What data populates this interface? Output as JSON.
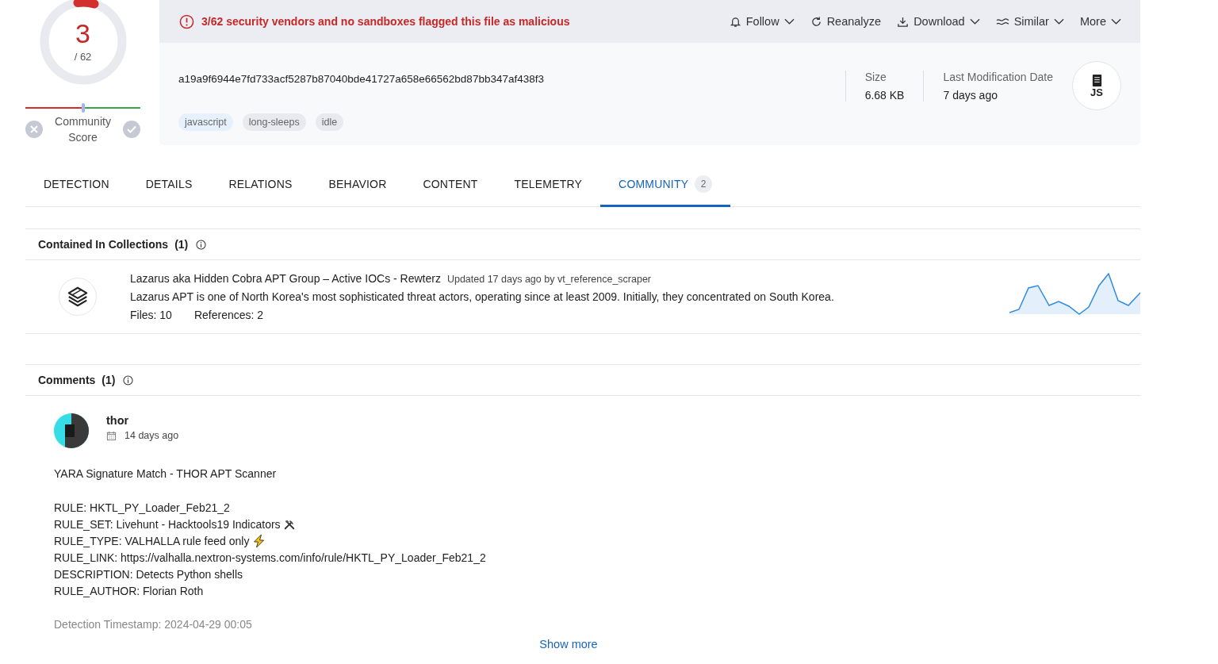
{
  "score": {
    "detections": "3",
    "total": "/ 62",
    "community_label": "Community Score",
    "community": {
      "level": 0.5
    }
  },
  "alert": {
    "message": "3/62 security vendors and no sandboxes flagged this file as malicious"
  },
  "actions": [
    {
      "label": "Follow",
      "kind": "bell",
      "dropdown": true
    },
    {
      "label": "Reanalyze",
      "kind": "refresh",
      "dropdown": false
    },
    {
      "label": "Download",
      "kind": "download",
      "dropdown": true
    },
    {
      "label": "Similar",
      "kind": "similar",
      "dropdown": true
    },
    {
      "label": "More",
      "kind": "plain",
      "dropdown": true
    }
  ],
  "file": {
    "hash": "a19a9f6944e7fd733acf5287b87040bde41727a658e66562bd87bb347af438f3",
    "tags": [
      {
        "label": "javascript",
        "kind": "type"
      },
      {
        "label": "long-sleeps",
        "kind": "tag"
      },
      {
        "label": "idle",
        "kind": "tag"
      }
    ],
    "size_label": "Size",
    "size": "6.68 KB",
    "date_label": "Last Modification Date",
    "date": "7 days ago",
    "type_badge": "JS"
  },
  "tabs": [
    {
      "label": "DETECTION",
      "selected": false
    },
    {
      "label": "DETAILS",
      "selected": false
    },
    {
      "label": "RELATIONS",
      "selected": false
    },
    {
      "label": "BEHAVIOR",
      "selected": false
    },
    {
      "label": "CONTENT",
      "selected": false
    },
    {
      "label": "TELEMETRY",
      "selected": false
    },
    {
      "label": "COMMUNITY",
      "selected": true,
      "count": "2"
    }
  ],
  "collections": {
    "title": "Contained In Collections",
    "count": "(1)",
    "items": [
      {
        "name": "Lazarus aka Hidden Cobra APT Group – Active IOCs - Rewterz",
        "updated": "Updated 17 days ago by vt_reference_scraper",
        "description": "Lazarus APT is one of North Korea's most sophisticated threat actors, operating since at least 2009. Initially, they concentrated on South Korea.",
        "files": "Files: 10",
        "references": "References: 2"
      }
    ]
  },
  "comments": {
    "title": "Comments",
    "count": "(1)",
    "items": [
      {
        "author": "thor",
        "time": "14 days ago",
        "heading": "YARA Signature Match - THOR APT Scanner",
        "lines": [
          {
            "text": "RULE: HKTL_PY_Loader_Feb21_2",
            "kind": "plain"
          },
          {
            "text": "RULE_SET: Livehunt - Hacktools19 Indicators",
            "kind": "tools"
          },
          {
            "text": "RULE_TYPE: VALHALLA rule feed only",
            "kind": "lightning"
          },
          {
            "text": "RULE_LINK: https://valhalla.nextron-systems.com/info/rule/HKTL_PY_Loader_Feb21_2",
            "kind": "plain"
          },
          {
            "text": "DESCRIPTION: Detects Python shells",
            "kind": "plain"
          },
          {
            "text": "RULE_AUTHOR: Florian Roth",
            "kind": "plain"
          }
        ],
        "footer": "Detection Timestamp: 2024-04-29 00:05"
      }
    ],
    "show_more": "Show more"
  }
}
